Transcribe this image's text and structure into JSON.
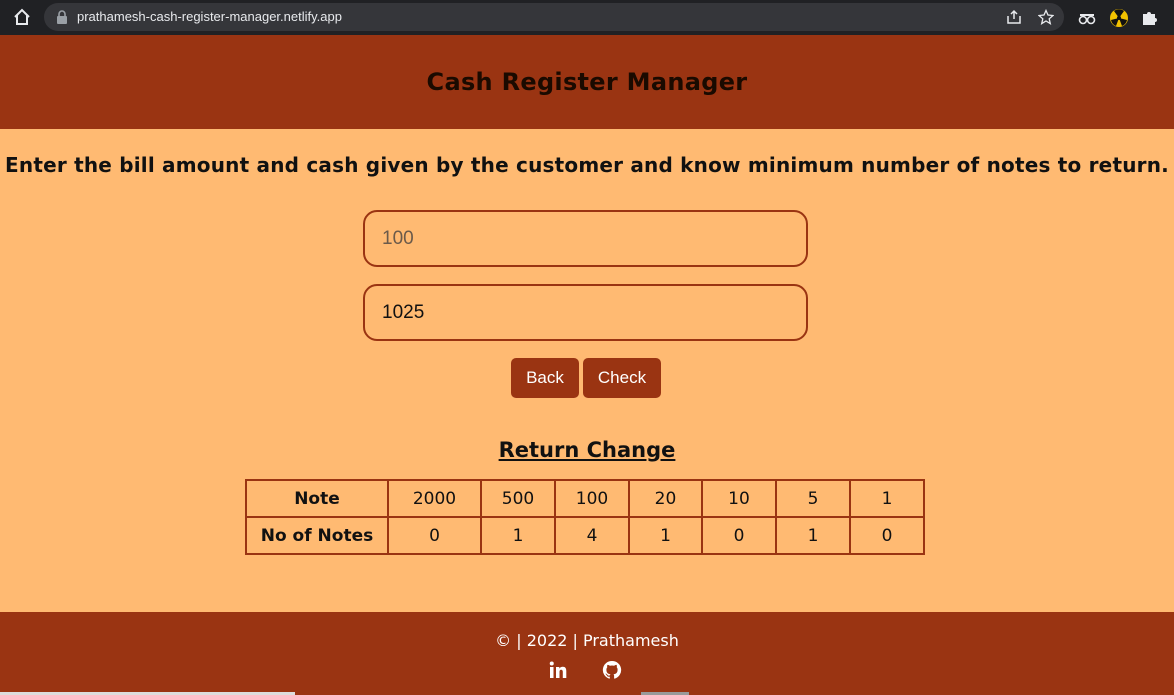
{
  "browser": {
    "url": "prathamesh-cash-register-manager.netlify.app"
  },
  "header": {
    "title": "Cash Register Manager"
  },
  "instruction": "Enter the bill amount and cash given by the customer and know minimum number of notes to return.",
  "form": {
    "bill_placeholder": "100",
    "bill_value": "",
    "cash_value": "1025",
    "back_label": "Back",
    "check_label": "Check"
  },
  "result": {
    "title": "Return Change",
    "row1_label": "Note",
    "row2_label": "No of Notes",
    "notes": [
      "2000",
      "500",
      "100",
      "20",
      "10",
      "5",
      "1"
    ],
    "counts": [
      "0",
      "1",
      "4",
      "1",
      "0",
      "1",
      "0"
    ]
  },
  "footer": {
    "copyright": "© | 2022 | Prathamesh",
    "icons": [
      "linkedin-icon",
      "github-icon"
    ]
  },
  "colors": {
    "accent": "#9A3412",
    "background": "#FFBA72"
  }
}
